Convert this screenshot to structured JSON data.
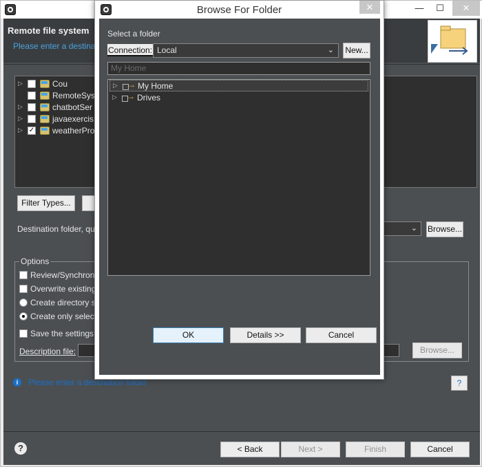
{
  "wizard": {
    "title": "Remote file system",
    "message": "Please enter a destination",
    "projects": [
      {
        "label": "Cou",
        "checked": false,
        "expandable": true
      },
      {
        "label": "RemoteSys",
        "checked": false,
        "expandable": false
      },
      {
        "label": "chatbotSer",
        "checked": false,
        "expandable": true
      },
      {
        "label": "javaexercis",
        "checked": false,
        "expandable": true
      },
      {
        "label": "weatherPro",
        "checked": true,
        "expandable": true
      }
    ],
    "filter_types_label": "Filter Types...",
    "destination_label": "Destination folder, qu",
    "browse_label": "Browse...",
    "options": {
      "group_label": "Options",
      "review_label": "Review/Synchroniz",
      "overwrite_label": "Overwrite existing",
      "create_structure_label": "Create directory st",
      "create_selected_label": "Create only selecte",
      "save_settings_label": "Save the settings o",
      "description_label": "Description file:",
      "browse_disabled_label": "Browse..."
    },
    "error_message": "Please enter a destination folder",
    "help_small": "?",
    "footer": {
      "help": "?",
      "back": "< Back",
      "next": "Next >",
      "finish": "Finish",
      "cancel": "Cancel"
    }
  },
  "dialog": {
    "title": "Browse For Folder",
    "close": "✕",
    "select_label": "Select a folder",
    "connection_label": "Connection:",
    "connection_value": "Local",
    "new_label": "New...",
    "path_placeholder": "My Home",
    "tree": [
      {
        "label": "My Home",
        "selected": true
      },
      {
        "label": "Drives",
        "selected": false
      }
    ],
    "ok": "OK",
    "details": "Details >>",
    "cancel": "Cancel"
  },
  "colors": {
    "accent": "#4aa3df",
    "error": "#1a6fc9",
    "dialog_background": "#4b4f52",
    "tree_background": "#2f2f2f"
  }
}
